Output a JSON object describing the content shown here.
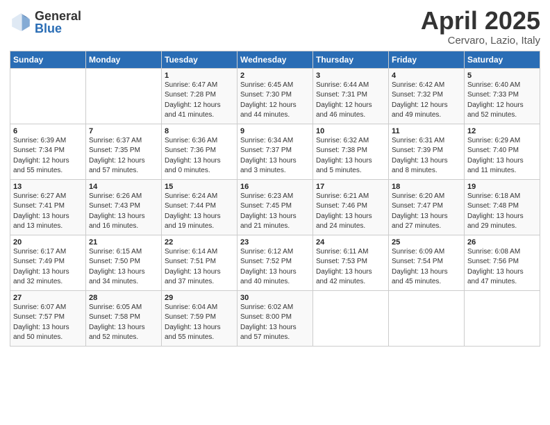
{
  "logo": {
    "general": "General",
    "blue": "Blue"
  },
  "title": {
    "month": "April 2025",
    "location": "Cervaro, Lazio, Italy"
  },
  "weekdays": [
    "Sunday",
    "Monday",
    "Tuesday",
    "Wednesday",
    "Thursday",
    "Friday",
    "Saturday"
  ],
  "weeks": [
    [
      {
        "day": "",
        "content": ""
      },
      {
        "day": "",
        "content": ""
      },
      {
        "day": "1",
        "content": "Sunrise: 6:47 AM\nSunset: 7:28 PM\nDaylight: 12 hours\nand 41 minutes."
      },
      {
        "day": "2",
        "content": "Sunrise: 6:45 AM\nSunset: 7:30 PM\nDaylight: 12 hours\nand 44 minutes."
      },
      {
        "day": "3",
        "content": "Sunrise: 6:44 AM\nSunset: 7:31 PM\nDaylight: 12 hours\nand 46 minutes."
      },
      {
        "day": "4",
        "content": "Sunrise: 6:42 AM\nSunset: 7:32 PM\nDaylight: 12 hours\nand 49 minutes."
      },
      {
        "day": "5",
        "content": "Sunrise: 6:40 AM\nSunset: 7:33 PM\nDaylight: 12 hours\nand 52 minutes."
      }
    ],
    [
      {
        "day": "6",
        "content": "Sunrise: 6:39 AM\nSunset: 7:34 PM\nDaylight: 12 hours\nand 55 minutes."
      },
      {
        "day": "7",
        "content": "Sunrise: 6:37 AM\nSunset: 7:35 PM\nDaylight: 12 hours\nand 57 minutes."
      },
      {
        "day": "8",
        "content": "Sunrise: 6:36 AM\nSunset: 7:36 PM\nDaylight: 13 hours\nand 0 minutes."
      },
      {
        "day": "9",
        "content": "Sunrise: 6:34 AM\nSunset: 7:37 PM\nDaylight: 13 hours\nand 3 minutes."
      },
      {
        "day": "10",
        "content": "Sunrise: 6:32 AM\nSunset: 7:38 PM\nDaylight: 13 hours\nand 5 minutes."
      },
      {
        "day": "11",
        "content": "Sunrise: 6:31 AM\nSunset: 7:39 PM\nDaylight: 13 hours\nand 8 minutes."
      },
      {
        "day": "12",
        "content": "Sunrise: 6:29 AM\nSunset: 7:40 PM\nDaylight: 13 hours\nand 11 minutes."
      }
    ],
    [
      {
        "day": "13",
        "content": "Sunrise: 6:27 AM\nSunset: 7:41 PM\nDaylight: 13 hours\nand 13 minutes."
      },
      {
        "day": "14",
        "content": "Sunrise: 6:26 AM\nSunset: 7:43 PM\nDaylight: 13 hours\nand 16 minutes."
      },
      {
        "day": "15",
        "content": "Sunrise: 6:24 AM\nSunset: 7:44 PM\nDaylight: 13 hours\nand 19 minutes."
      },
      {
        "day": "16",
        "content": "Sunrise: 6:23 AM\nSunset: 7:45 PM\nDaylight: 13 hours\nand 21 minutes."
      },
      {
        "day": "17",
        "content": "Sunrise: 6:21 AM\nSunset: 7:46 PM\nDaylight: 13 hours\nand 24 minutes."
      },
      {
        "day": "18",
        "content": "Sunrise: 6:20 AM\nSunset: 7:47 PM\nDaylight: 13 hours\nand 27 minutes."
      },
      {
        "day": "19",
        "content": "Sunrise: 6:18 AM\nSunset: 7:48 PM\nDaylight: 13 hours\nand 29 minutes."
      }
    ],
    [
      {
        "day": "20",
        "content": "Sunrise: 6:17 AM\nSunset: 7:49 PM\nDaylight: 13 hours\nand 32 minutes."
      },
      {
        "day": "21",
        "content": "Sunrise: 6:15 AM\nSunset: 7:50 PM\nDaylight: 13 hours\nand 34 minutes."
      },
      {
        "day": "22",
        "content": "Sunrise: 6:14 AM\nSunset: 7:51 PM\nDaylight: 13 hours\nand 37 minutes."
      },
      {
        "day": "23",
        "content": "Sunrise: 6:12 AM\nSunset: 7:52 PM\nDaylight: 13 hours\nand 40 minutes."
      },
      {
        "day": "24",
        "content": "Sunrise: 6:11 AM\nSunset: 7:53 PM\nDaylight: 13 hours\nand 42 minutes."
      },
      {
        "day": "25",
        "content": "Sunrise: 6:09 AM\nSunset: 7:54 PM\nDaylight: 13 hours\nand 45 minutes."
      },
      {
        "day": "26",
        "content": "Sunrise: 6:08 AM\nSunset: 7:56 PM\nDaylight: 13 hours\nand 47 minutes."
      }
    ],
    [
      {
        "day": "27",
        "content": "Sunrise: 6:07 AM\nSunset: 7:57 PM\nDaylight: 13 hours\nand 50 minutes."
      },
      {
        "day": "28",
        "content": "Sunrise: 6:05 AM\nSunset: 7:58 PM\nDaylight: 13 hours\nand 52 minutes."
      },
      {
        "day": "29",
        "content": "Sunrise: 6:04 AM\nSunset: 7:59 PM\nDaylight: 13 hours\nand 55 minutes."
      },
      {
        "day": "30",
        "content": "Sunrise: 6:02 AM\nSunset: 8:00 PM\nDaylight: 13 hours\nand 57 minutes."
      },
      {
        "day": "",
        "content": ""
      },
      {
        "day": "",
        "content": ""
      },
      {
        "day": "",
        "content": ""
      }
    ]
  ]
}
